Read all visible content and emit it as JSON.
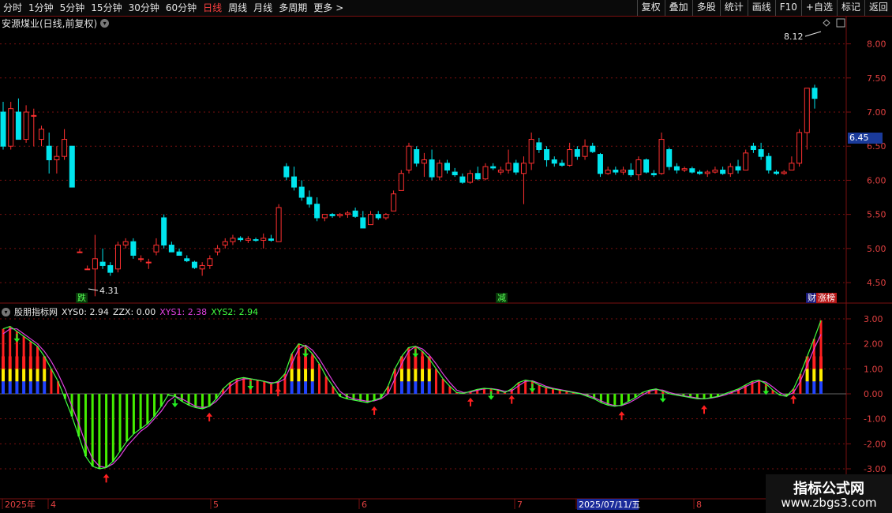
{
  "toolbar": {
    "periods": [
      "分时",
      "1分钟",
      "5分钟",
      "15分钟",
      "30分钟",
      "60分钟",
      "日线",
      "周线",
      "月线",
      "多周期",
      "更多"
    ],
    "active_period": "日线",
    "more_arrow": ">",
    "buttons": [
      "复权",
      "叠加",
      "多股",
      "统计",
      "画线",
      "F10",
      "+自选",
      "标记",
      "返回"
    ]
  },
  "main_chart": {
    "title": "安源煤业(日线,前复权)",
    "high_marker": "8.12",
    "low_marker": "4.31",
    "current_price": "6.45",
    "y_ticks": [
      "8.00",
      "7.50",
      "7.00",
      "6.50",
      "6.00",
      "5.50",
      "5.00",
      "4.50"
    ],
    "signals": [
      "跌",
      "减",
      "财",
      "涨榜"
    ]
  },
  "indicator": {
    "name": "股朋指标网",
    "labels": [
      {
        "text": "XYS0: 2.94",
        "color": "#e8e8e8"
      },
      {
        "text": "ZZX: 0.00",
        "color": "#e8e8e8"
      },
      {
        "text": "XYS1: 2.38",
        "color": "#e040e0"
      },
      {
        "text": "XYS2: 2.94",
        "color": "#40ff40"
      }
    ],
    "y_ticks": [
      "3.00",
      "2.00",
      "1.00",
      "0.00",
      "-1.00",
      "-2.00",
      "-3.00"
    ]
  },
  "date_axis": {
    "labels": [
      "2025年",
      "4",
      "5",
      "6",
      "7",
      "2025/07/11/五",
      "8"
    ]
  },
  "watermark": {
    "line1": "指标公式网",
    "line2": "www.zbgs3.com"
  },
  "colors": {
    "up": "#ff3030",
    "down": "#00e5ee",
    "grid": "#7a1010",
    "bar_pos": "#ff2020",
    "bar_neg": "#44ee00"
  },
  "chart_data": [
    {
      "type": "candlestick",
      "title": "安源煤业(日线,前复权)",
      "ylim": [
        4.2,
        8.4
      ],
      "candles": [
        [
          7.0,
          7.15,
          6.45,
          6.5
        ],
        [
          6.5,
          7.15,
          6.45,
          7.05
        ],
        [
          7.0,
          7.2,
          6.6,
          6.6
        ],
        [
          6.6,
          7.1,
          6.55,
          7.0
        ],
        [
          6.95,
          7.05,
          6.5,
          6.95
        ],
        [
          6.6,
          6.8,
          6.5,
          6.75
        ],
        [
          6.5,
          6.7,
          6.1,
          6.3
        ],
        [
          6.3,
          6.5,
          6.1,
          6.35
        ],
        [
          6.35,
          6.75,
          6.3,
          6.6
        ],
        [
          6.5,
          6.5,
          5.9,
          5.9
        ],
        [
          4.95,
          5.0,
          4.95,
          4.95
        ],
        [
          4.7,
          4.75,
          4.7,
          4.7
        ],
        [
          4.7,
          5.2,
          4.3,
          4.85
        ],
        [
          4.8,
          5.0,
          4.7,
          4.75
        ],
        [
          4.75,
          4.8,
          4.6,
          4.65
        ],
        [
          4.7,
          5.1,
          4.65,
          5.05
        ],
        [
          5.05,
          5.15,
          5.0,
          5.1
        ],
        [
          5.1,
          5.15,
          4.85,
          4.9
        ],
        [
          4.85,
          4.9,
          4.8,
          4.85
        ],
        [
          4.8,
          4.85,
          4.7,
          4.8
        ],
        [
          4.95,
          5.15,
          4.9,
          5.05
        ],
        [
          5.45,
          5.5,
          5.0,
          5.05
        ],
        [
          5.05,
          5.1,
          4.95,
          4.95
        ],
        [
          4.95,
          5.0,
          4.9,
          4.9
        ],
        [
          4.85,
          4.9,
          4.8,
          4.82
        ],
        [
          4.8,
          4.82,
          4.7,
          4.72
        ],
        [
          4.7,
          4.8,
          4.6,
          4.75
        ],
        [
          4.75,
          4.9,
          4.7,
          4.85
        ],
        [
          4.95,
          5.05,
          4.9,
          5.0
        ],
        [
          5.05,
          5.15,
          5.0,
          5.1
        ],
        [
          5.1,
          5.2,
          5.05,
          5.15
        ],
        [
          5.15,
          5.18,
          5.1,
          5.13
        ],
        [
          5.12,
          5.18,
          5.08,
          5.14
        ],
        [
          5.13,
          5.16,
          5.1,
          5.12
        ],
        [
          5.12,
          5.22,
          5.0,
          5.15
        ],
        [
          5.14,
          5.2,
          5.1,
          5.12
        ],
        [
          5.1,
          5.65,
          5.1,
          5.6
        ],
        [
          6.2,
          6.25,
          6.0,
          6.05
        ],
        [
          6.05,
          6.2,
          5.85,
          5.9
        ],
        [
          5.9,
          6.0,
          5.7,
          5.75
        ],
        [
          5.75,
          5.85,
          5.6,
          5.65
        ],
        [
          5.65,
          5.75,
          5.4,
          5.45
        ],
        [
          5.45,
          5.5,
          5.4,
          5.5
        ],
        [
          5.5,
          5.52,
          5.45,
          5.48
        ],
        [
          5.48,
          5.52,
          5.45,
          5.5
        ],
        [
          5.5,
          5.55,
          5.45,
          5.52
        ],
        [
          5.55,
          5.6,
          5.45,
          5.47
        ],
        [
          5.45,
          5.55,
          5.3,
          5.3
        ],
        [
          5.35,
          5.55,
          5.35,
          5.5
        ],
        [
          5.5,
          5.55,
          5.42,
          5.45
        ],
        [
          5.45,
          5.52,
          5.42,
          5.5
        ],
        [
          5.55,
          5.85,
          5.55,
          5.8
        ],
        [
          5.85,
          6.15,
          5.85,
          6.1
        ],
        [
          6.15,
          6.55,
          6.1,
          6.5
        ],
        [
          6.45,
          6.5,
          6.2,
          6.25
        ],
        [
          6.25,
          6.4,
          6.05,
          6.3
        ],
        [
          6.3,
          6.45,
          6.0,
          6.05
        ],
        [
          6.05,
          6.3,
          6.0,
          6.25
        ],
        [
          6.25,
          6.3,
          6.1,
          6.15
        ],
        [
          6.12,
          6.18,
          6.05,
          6.08
        ],
        [
          6.05,
          6.1,
          5.95,
          5.97
        ],
        [
          5.97,
          6.15,
          5.95,
          6.1
        ],
        [
          6.1,
          6.2,
          6.0,
          6.02
        ],
        [
          6.02,
          6.25,
          6.0,
          6.2
        ],
        [
          6.2,
          6.25,
          6.15,
          6.18
        ],
        [
          6.12,
          6.2,
          6.08,
          6.15
        ],
        [
          6.15,
          6.45,
          6.1,
          6.25
        ],
        [
          6.25,
          6.3,
          6.08,
          6.12
        ],
        [
          6.1,
          6.35,
          5.65,
          6.25
        ],
        [
          6.25,
          6.7,
          6.15,
          6.6
        ],
        [
          6.55,
          6.62,
          6.4,
          6.45
        ],
        [
          6.45,
          6.5,
          6.2,
          6.3
        ],
        [
          6.3,
          6.35,
          6.2,
          6.25
        ],
        [
          6.25,
          6.3,
          6.2,
          6.22
        ],
        [
          6.22,
          6.55,
          6.2,
          6.45
        ],
        [
          6.45,
          6.5,
          6.3,
          6.35
        ],
        [
          6.35,
          6.6,
          6.3,
          6.5
        ],
        [
          6.5,
          6.55,
          6.4,
          6.42
        ],
        [
          6.38,
          6.4,
          6.05,
          6.1
        ],
        [
          6.1,
          6.2,
          6.08,
          6.15
        ],
        [
          6.15,
          6.2,
          6.08,
          6.12
        ],
        [
          6.12,
          6.2,
          6.08,
          6.15
        ],
        [
          6.15,
          6.25,
          6.05,
          6.08
        ],
        [
          6.08,
          6.35,
          6.0,
          6.3
        ],
        [
          6.3,
          6.32,
          6.1,
          6.12
        ],
        [
          6.1,
          6.15,
          6.05,
          6.08
        ],
        [
          6.1,
          6.7,
          6.08,
          6.6
        ],
        [
          6.45,
          6.48,
          6.15,
          6.2
        ],
        [
          6.2,
          6.25,
          6.1,
          6.15
        ],
        [
          6.15,
          6.2,
          6.12,
          6.17
        ],
        [
          6.17,
          6.2,
          6.1,
          6.12
        ],
        [
          6.12,
          6.15,
          6.08,
          6.1
        ],
        [
          6.1,
          6.15,
          6.05,
          6.12
        ],
        [
          6.12,
          6.2,
          6.1,
          6.15
        ],
        [
          6.15,
          6.2,
          6.08,
          6.1
        ],
        [
          6.1,
          6.25,
          6.05,
          6.2
        ],
        [
          6.2,
          6.3,
          6.1,
          6.15
        ],
        [
          6.15,
          6.45,
          6.15,
          6.4
        ],
        [
          6.5,
          6.55,
          6.4,
          6.45
        ],
        [
          6.45,
          6.55,
          6.3,
          6.35
        ],
        [
          6.35,
          6.4,
          6.1,
          6.15
        ],
        [
          6.12,
          6.15,
          6.08,
          6.1
        ],
        [
          6.1,
          6.15,
          6.08,
          6.12
        ],
        [
          6.15,
          6.35,
          6.15,
          6.25
        ],
        [
          6.25,
          6.75,
          6.2,
          6.7
        ],
        [
          6.7,
          7.35,
          6.45,
          7.35
        ],
        [
          7.35,
          7.4,
          7.05,
          7.2
        ]
      ]
    },
    {
      "type": "bar",
      "title": "股朋指标网",
      "ylim": [
        -3.0,
        3.0
      ],
      "zero_line": 0.0,
      "series": [
        {
          "name": "XYS0",
          "values": [
            2.6,
            2.7,
            2.5,
            2.3,
            2.1,
            1.9,
            1.5,
            1.0,
            0.5,
            -0.2,
            -0.9,
            -1.7,
            -2.5,
            -2.9,
            -3.0,
            -2.95,
            -2.7,
            -2.3,
            -1.9,
            -1.6,
            -1.4,
            -1.2,
            -0.9,
            -0.5,
            -0.05,
            -0.1,
            -0.3,
            -0.45,
            -0.55,
            -0.6,
            -0.5,
            -0.2,
            0.2,
            0.45,
            0.6,
            0.65,
            0.6,
            0.55,
            0.5,
            0.4,
            0.5,
            0.8,
            1.6,
            2.0,
            1.9,
            1.6,
            1.2,
            0.7,
            0.3,
            -0.1,
            -0.2,
            -0.25,
            -0.3,
            -0.35,
            -0.25,
            -0.15,
            0.3,
            1.0,
            1.5,
            1.85,
            1.9,
            1.7,
            1.4,
            1.0,
            0.6,
            0.3,
            0.05,
            0.02,
            0.1,
            0.18,
            0.22,
            0.2,
            0.15,
            0.05,
            0.2,
            0.45,
            0.55,
            0.5,
            0.35,
            0.25,
            0.2,
            0.15,
            0.1,
            0.05,
            0.0,
            -0.1,
            -0.2,
            -0.35,
            -0.45,
            -0.5,
            -0.45,
            -0.3,
            -0.15,
            0.05,
            0.15,
            0.2,
            0.1,
            0.0,
            -0.05,
            -0.1,
            -0.15,
            -0.2,
            -0.2,
            -0.15,
            -0.1,
            0.0,
            0.1,
            0.2,
            0.35,
            0.5,
            0.55,
            0.4,
            0.15,
            -0.05,
            -0.1,
            0.2,
            0.8,
            1.5,
            2.2,
            2.94
          ]
        },
        {
          "name": "XYS1",
          "values": [
            2.4,
            2.6,
            2.6,
            2.4,
            2.2,
            2.0,
            1.7,
            1.3,
            0.8,
            0.2,
            -0.5,
            -1.2,
            -2.0,
            -2.6,
            -2.9,
            -2.95,
            -2.8,
            -2.5,
            -2.1,
            -1.8,
            -1.5,
            -1.3,
            -1.0,
            -0.7,
            -0.3,
            -0.1,
            -0.2,
            -0.35,
            -0.5,
            -0.55,
            -0.5,
            -0.3,
            0.0,
            0.3,
            0.5,
            0.6,
            0.6,
            0.55,
            0.5,
            0.45,
            0.45,
            0.6,
            1.2,
            1.8,
            1.95,
            1.75,
            1.4,
            0.95,
            0.5,
            0.1,
            -0.1,
            -0.2,
            -0.25,
            -0.3,
            -0.28,
            -0.2,
            0.0,
            0.6,
            1.2,
            1.7,
            1.9,
            1.8,
            1.55,
            1.2,
            0.8,
            0.45,
            0.15,
            0.05,
            0.07,
            0.14,
            0.2,
            0.21,
            0.17,
            0.1,
            0.12,
            0.32,
            0.5,
            0.52,
            0.42,
            0.3,
            0.22,
            0.17,
            0.12,
            0.07,
            0.02,
            -0.05,
            -0.15,
            -0.28,
            -0.4,
            -0.47,
            -0.47,
            -0.37,
            -0.22,
            -0.05,
            0.1,
            0.17,
            0.15,
            0.05,
            -0.02,
            -0.08,
            -0.12,
            -0.17,
            -0.2,
            -0.17,
            -0.12,
            -0.05,
            0.05,
            0.15,
            0.28,
            0.42,
            0.52,
            0.47,
            0.27,
            0.05,
            -0.08,
            0.05,
            0.5,
            1.15,
            1.8,
            2.38
          ]
        }
      ]
    }
  ]
}
